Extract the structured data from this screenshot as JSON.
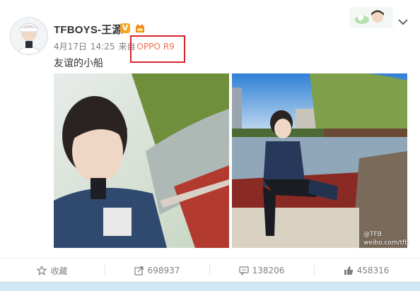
{
  "post": {
    "username": "TFBOYS-王源",
    "verified_icon": "verified-badge-icon",
    "verified_symbol": "V",
    "date": "4月17日",
    "time": "14:25",
    "from_label": "来自",
    "device": "OPPO R9",
    "text": "友谊的小船"
  },
  "watermark": {
    "line1": "@TFB",
    "line2": "weibo.com/tfb"
  },
  "actions": [
    {
      "icon": "star-icon",
      "label": "收藏"
    },
    {
      "icon": "share-icon",
      "label": "698937"
    },
    {
      "icon": "comment-icon",
      "label": "138206"
    },
    {
      "icon": "thumbs-up-icon",
      "label": "458316"
    }
  ],
  "colors": {
    "device_link": "#eb7350",
    "highlight_box": "#d9232b",
    "verified": "#f5a623",
    "meta_text": "#808080"
  }
}
